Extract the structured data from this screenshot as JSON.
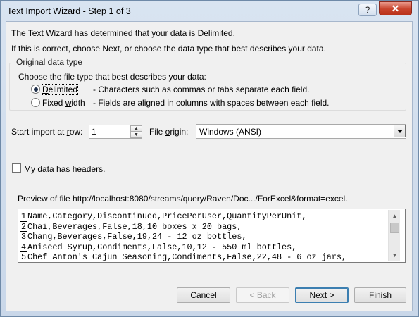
{
  "window": {
    "title": "Text Import Wizard - Step 1 of 3",
    "help_label": "?",
    "close_label": "✕"
  },
  "intro": {
    "line1": "The Text Wizard has determined that your data is Delimited.",
    "line2": "If this is correct, choose Next, or choose the data type that best describes your data."
  },
  "original_data_type": {
    "group_label": "Original data type",
    "prompt": "Choose the file type that best describes your data:",
    "options": [
      {
        "label": "Delimited",
        "description": "- Characters such as commas or tabs separate each field.",
        "selected": true
      },
      {
        "label": "Fixed width",
        "description": "- Fields are aligned in columns with spaces between each field.",
        "selected": false
      }
    ]
  },
  "import_settings": {
    "start_row_label": "Start import at row:",
    "start_row_value": "1",
    "file_origin_label": "File origin:",
    "file_origin_value": "Windows (ANSI)"
  },
  "headers_checkbox": {
    "label": "My data has headers.",
    "checked": false
  },
  "preview": {
    "label": "Preview of file http://localhost:8080/streams/query/Raven/Doc.../ForExcel&format=excel.",
    "rows": [
      {
        "num": "1",
        "text": "Name,Category,Discontinued,PricePerUser,QuantityPerUnit,"
      },
      {
        "num": "2",
        "text": "Chai,Beverages,False,18,10 boxes x 20 bags,"
      },
      {
        "num": "3",
        "text": "Chang,Beverages,False,19,24 - 12 oz bottles,"
      },
      {
        "num": "4",
        "text": "Aniseed Syrup,Condiments,False,10,12 - 550 ml bottles,"
      },
      {
        "num": "5",
        "text": "Chef Anton's Cajun Seasoning,Condiments,False,22,48 - 6 oz jars,"
      }
    ]
  },
  "buttons": {
    "cancel": "Cancel",
    "back": "< Back",
    "next": "Next >",
    "finish": "Finish"
  },
  "colors": {
    "title_bar": "#cfdbea",
    "close_button": "#c8442c",
    "dialog_bg": "#f0f0f0",
    "default_button_border": "#3c7fb1"
  }
}
